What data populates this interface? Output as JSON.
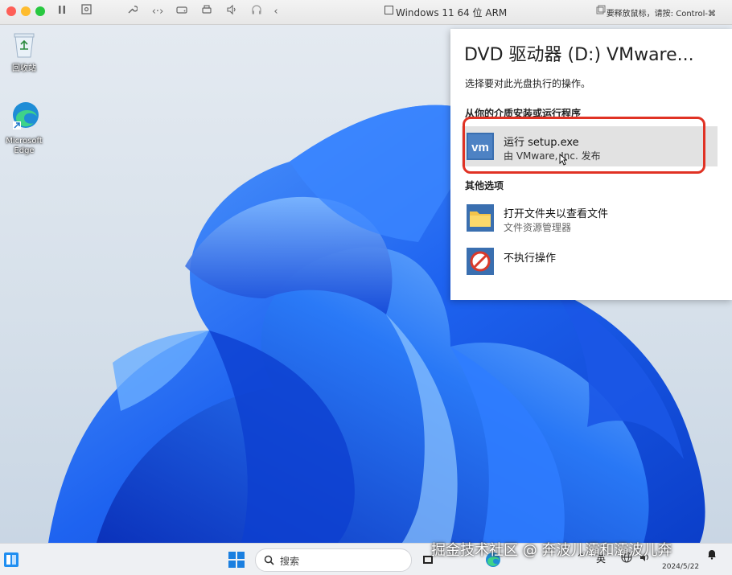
{
  "window": {
    "title": "Windows 11 64 位 ARM",
    "release_hint": "要释放鼠标，请按: Control-⌘",
    "controls": [
      "close",
      "minimize",
      "zoom"
    ]
  },
  "colors": {
    "close": "#fe5f57",
    "minimize": "#febc2e",
    "zoom": "#28c840",
    "highlight_border": "#e03224",
    "vmware_tile": "#3a6fb0"
  },
  "desktop": {
    "icons": [
      {
        "label": "回收站",
        "icon": "recycle-bin-icon"
      },
      {
        "label": "Microsoft Edge",
        "icon": "edge-icon"
      }
    ]
  },
  "autoplay": {
    "title": "DVD 驱动器 (D:) VMware...",
    "subtitle": "选择要对此光盘执行的操作。",
    "section_install": "从你的介质安装或运行程序",
    "run": {
      "main": "运行 setup.exe",
      "publisher": "由 VMware, Inc. 发布",
      "icon_text": "vm"
    },
    "section_other": "其他选项",
    "open_folder": {
      "main": "打开文件夹以查看文件",
      "secondary": "文件资源管理器"
    },
    "no_action": {
      "main": "不执行操作"
    }
  },
  "taskbar": {
    "search_placeholder": "搜索",
    "ime": "英",
    "date": "2024/5/22",
    "watermark": "掘金技术社区 @ 奔波儿灞和灞波儿奔"
  }
}
